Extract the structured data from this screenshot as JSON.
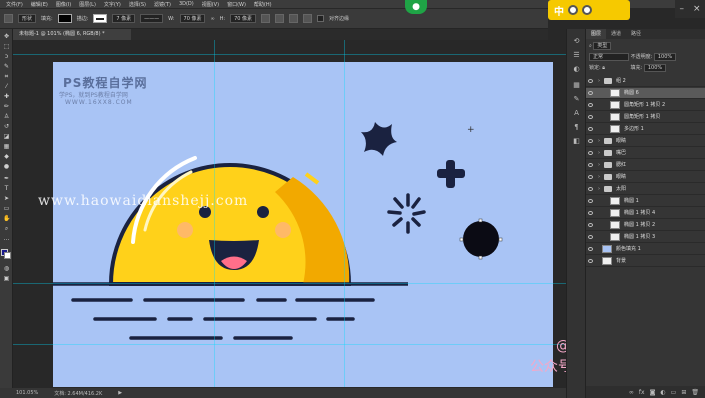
{
  "menubar": {
    "items": [
      "文件(F)",
      "编辑(E)",
      "图像(I)",
      "图层(L)",
      "文字(Y)",
      "选择(S)",
      "滤镜(T)",
      "3D(D)",
      "视图(V)",
      "窗口(W)",
      "帮助(H)"
    ]
  },
  "options_bar": {
    "mode": "形状",
    "fill_label": "填充:",
    "stroke_label": "描边:",
    "stroke_width": "7 像素",
    "w_label": "W:",
    "w_value": "70 像素",
    "h_label": "H:",
    "h_value": "70 像素",
    "align_edges": "对齐边缘"
  },
  "ime": {
    "label": "中"
  },
  "document_tab": {
    "title": "未标题-1 @ 101% (椭圆 6, RGB/8) *"
  },
  "status": {
    "zoom": "101.05%",
    "doc": "文档: 2.64M/416.2K"
  },
  "watermarks": {
    "title": "PS教程自学网",
    "subtitle": "学PS，就到PS教程自学网",
    "url": "WWW.16XX8.COM",
    "site": "www.haowaidianshejj.com",
    "author1": "@卡乐筠",
    "author2": "公众号：卡乐筠"
  },
  "layers_panel": {
    "tabs": [
      "图层",
      "通道",
      "路径"
    ],
    "filter_label": "类型",
    "blend_mode": "正常",
    "opacity_label": "不透明度:",
    "opacity": "100%",
    "lock_label": "锁定:",
    "fill_label": "填充:",
    "fill": "100%",
    "layers": [
      {
        "name": "组 2",
        "type": "group",
        "indent": 0,
        "selected": false
      },
      {
        "name": "椭圆 6",
        "type": "shape",
        "indent": 1,
        "selected": true
      },
      {
        "name": "圆角矩形 1 拷贝 2",
        "type": "shape",
        "indent": 1,
        "selected": false
      },
      {
        "name": "圆角矩形 1 拷贝",
        "type": "shape",
        "indent": 1,
        "selected": false
      },
      {
        "name": "多边形 1",
        "type": "shape",
        "indent": 1,
        "selected": false
      },
      {
        "name": "眼睛",
        "type": "group",
        "indent": 0,
        "selected": false
      },
      {
        "name": "嘴巴",
        "type": "group",
        "indent": 0,
        "selected": false
      },
      {
        "name": "腮红",
        "type": "group",
        "indent": 0,
        "selected": false
      },
      {
        "name": "眼睛",
        "type": "group",
        "indent": 0,
        "selected": false
      },
      {
        "name": "太阳",
        "type": "group",
        "indent": 0,
        "selected": false
      },
      {
        "name": "椭圆 1",
        "type": "shape",
        "indent": 1,
        "selected": false
      },
      {
        "name": "椭圆 1 拷贝 4",
        "type": "shape",
        "indent": 1,
        "selected": false
      },
      {
        "name": "椭圆 1 拷贝 2",
        "type": "shape",
        "indent": 1,
        "selected": false
      },
      {
        "name": "椭圆 1 拷贝 3",
        "type": "shape",
        "indent": 1,
        "selected": false
      },
      {
        "name": "颜色填充 1",
        "type": "fill",
        "indent": 0,
        "selected": false
      },
      {
        "name": "背景",
        "type": "background",
        "indent": 0,
        "selected": false
      }
    ]
  },
  "colors": {
    "canvas_bg": "#a9c4f5",
    "sun": "#ffd11a",
    "sun_dark": "#f2a900",
    "outline": "#1a2240",
    "blush": "#ffb37a",
    "tongue": "#ff6f8a",
    "panel_bg": "#353535"
  }
}
